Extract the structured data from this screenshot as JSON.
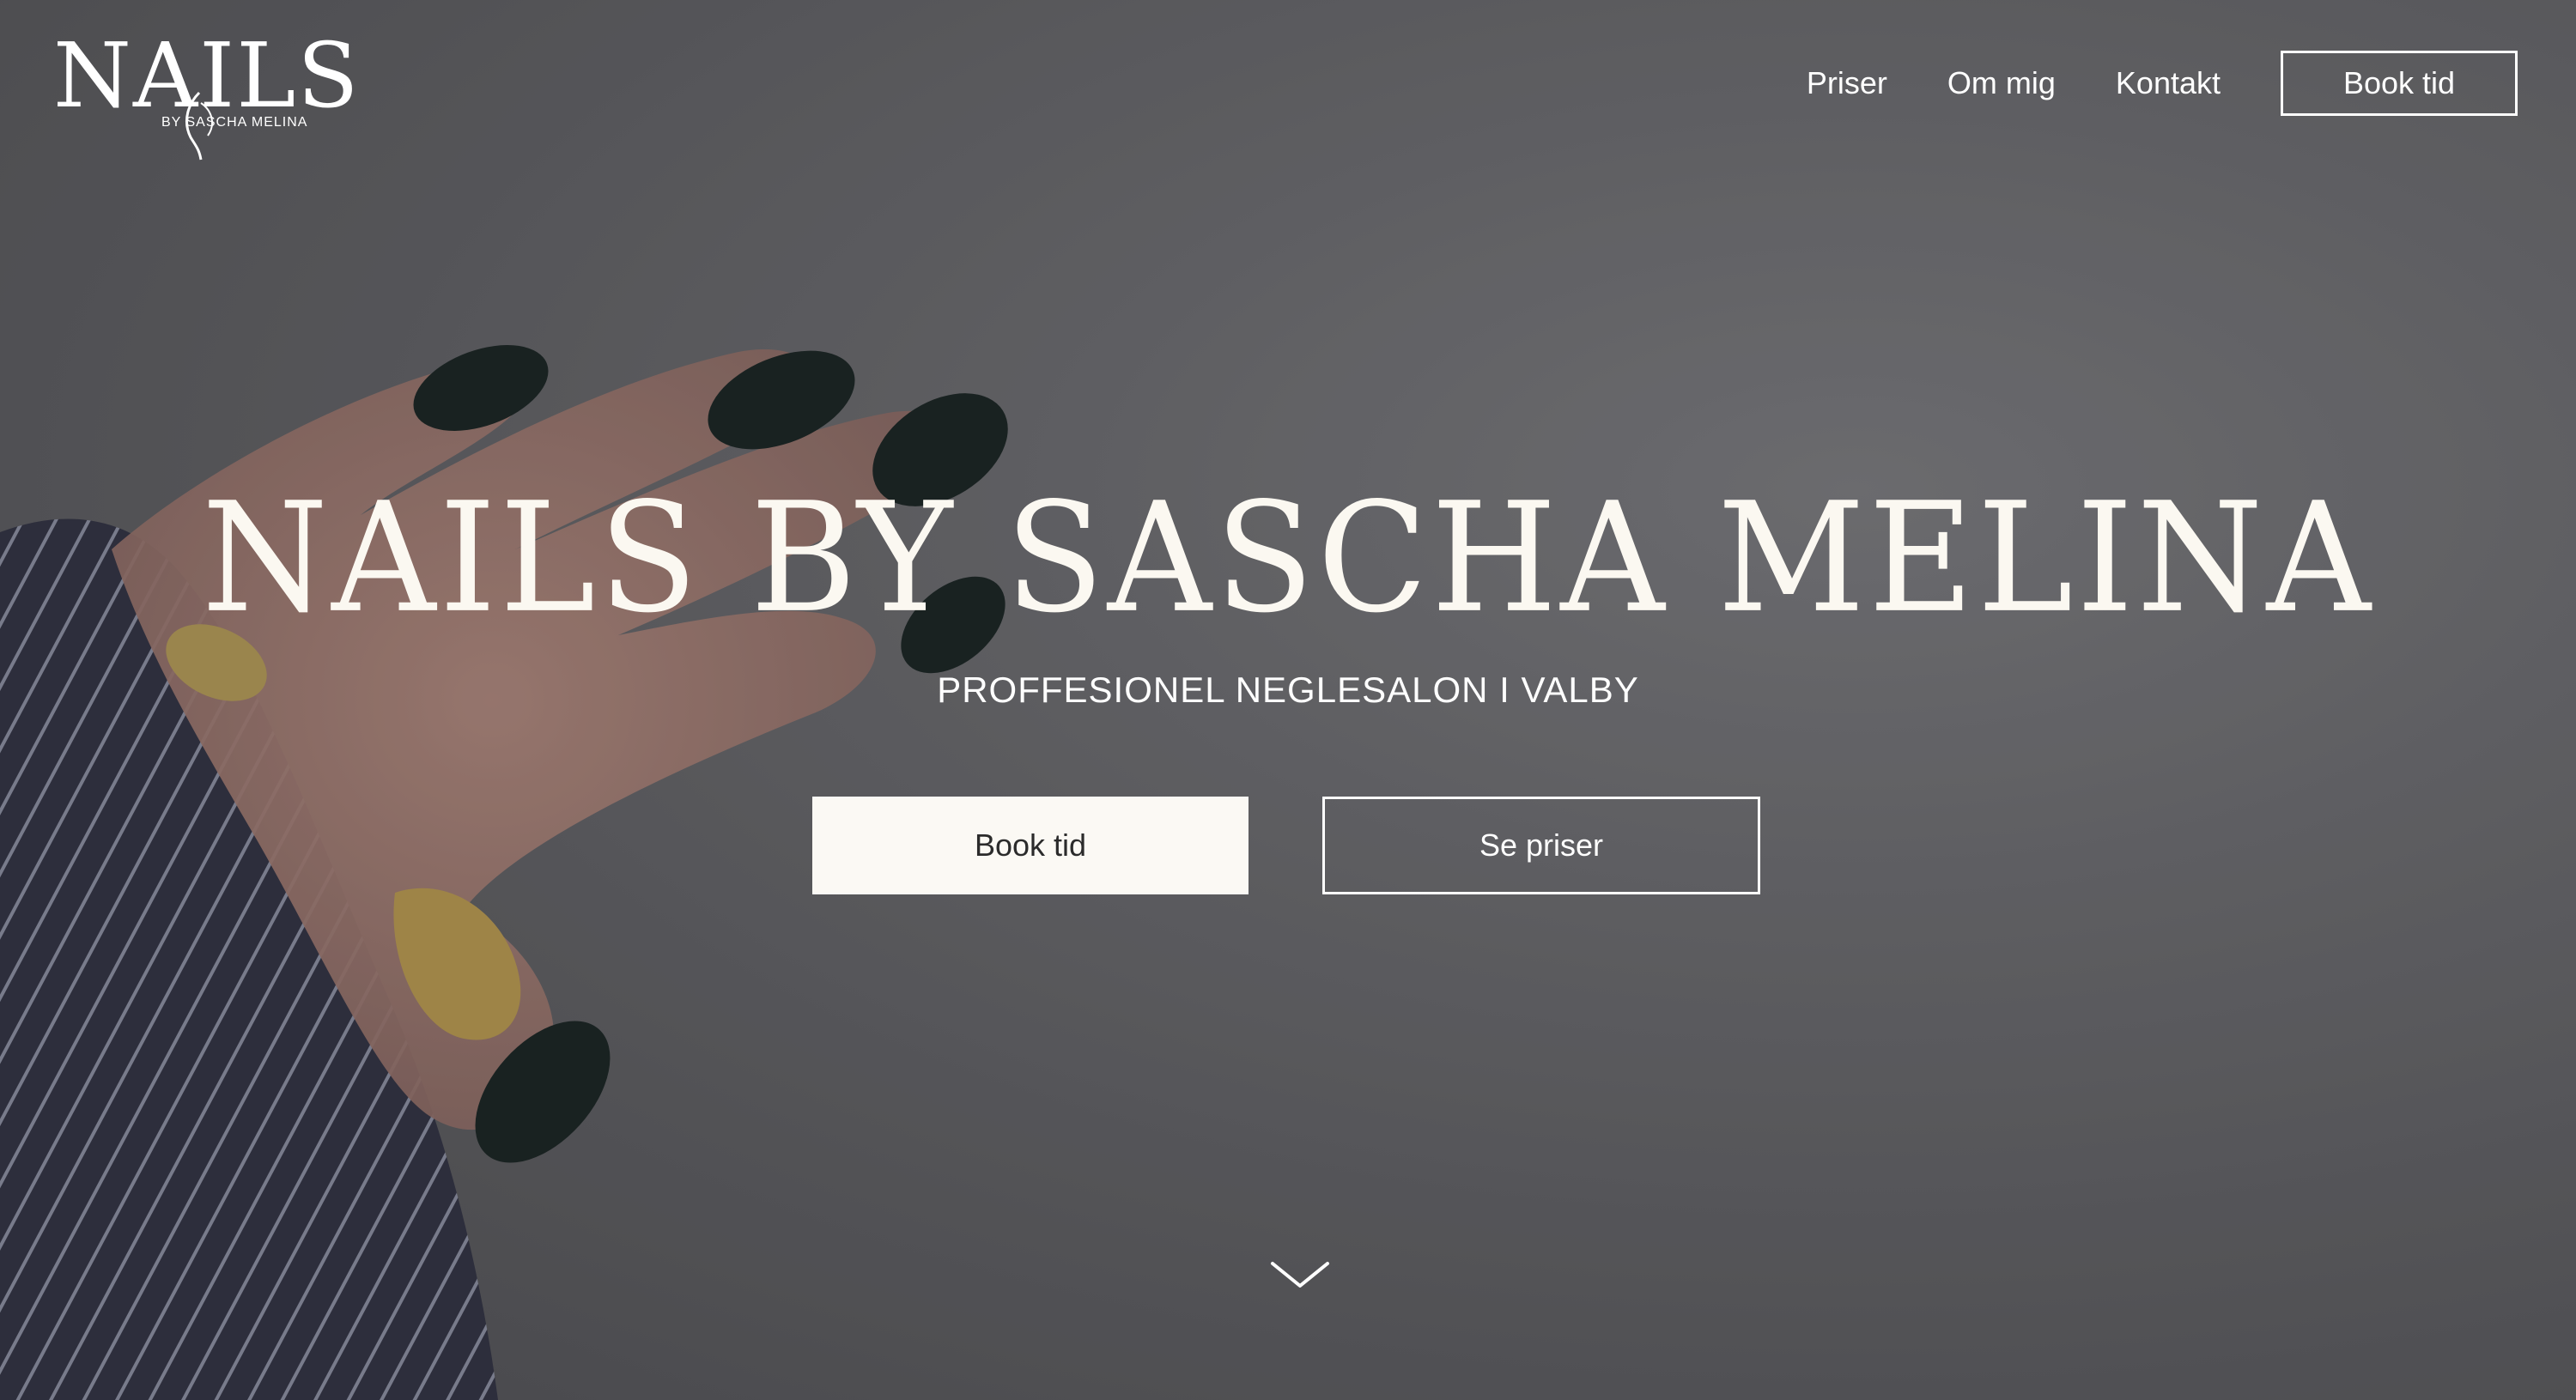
{
  "header": {
    "logo_word": "NAILS",
    "logo_sub": "BY SASCHA MELINA",
    "nav": [
      {
        "label": "Priser"
      },
      {
        "label": "Om mig"
      },
      {
        "label": "Kontakt"
      }
    ],
    "book_label": "Book tid"
  },
  "hero": {
    "title": "NAILS BY SASCHA MELINA",
    "subtitle": "PROFFESIONEL NEGLESALON I VALBY",
    "primary_cta": "Book tid",
    "secondary_cta": "Se priser",
    "scroll_icon": "chevron-down-icon"
  },
  "colors": {
    "text": "#ffffff",
    "primary_button_bg": "#fbf9f4",
    "primary_button_text": "#2b2b2b",
    "background": "#5e5e61"
  }
}
